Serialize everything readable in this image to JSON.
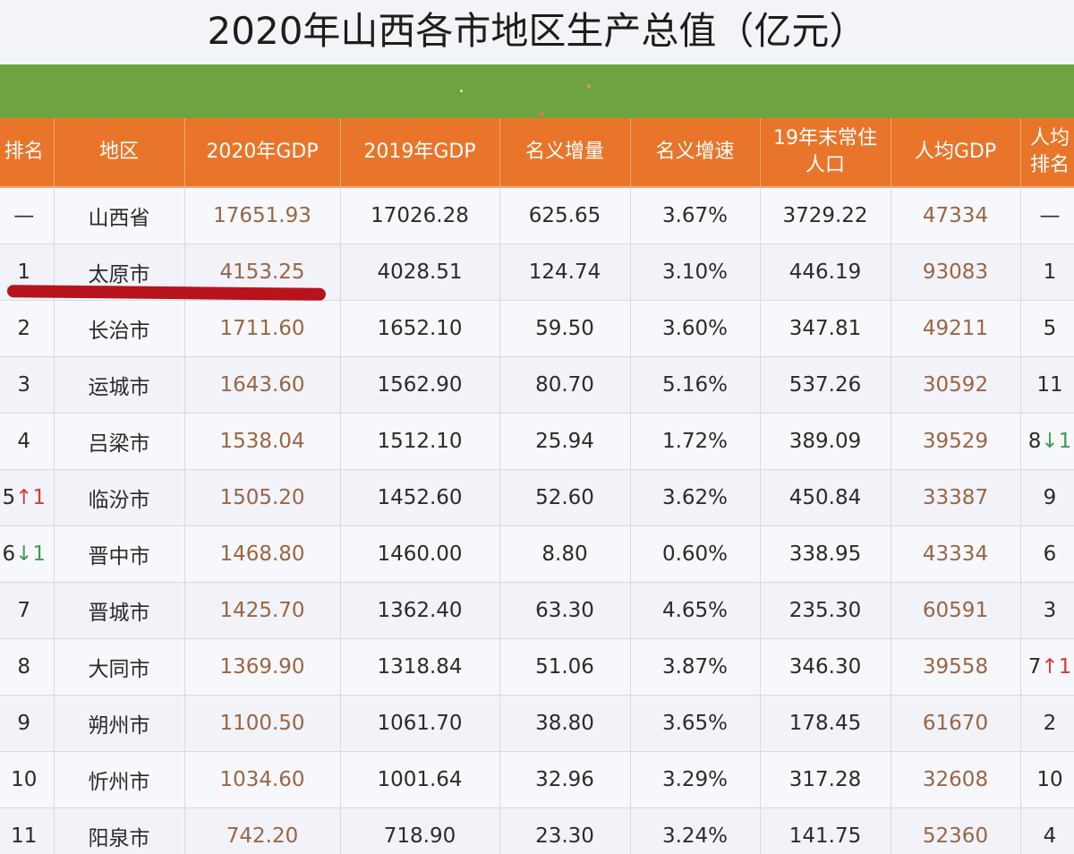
{
  "title": "2020年山西各市地区生产总值（亿元）",
  "headers": {
    "rank": "排名",
    "region": "地区",
    "gdp2020": "2020年GDP",
    "gdp2019": "2019年GDP",
    "increment": "名义增量",
    "growth": "名义增速",
    "population_line1": "19年末常住",
    "population_line2": "人口",
    "per_capita": "人均GDP",
    "pc_rank_line1": "人均",
    "pc_rank_line2": "排名"
  },
  "rows": [
    {
      "rank": "—",
      "rank_arrow": "",
      "region": "山西省",
      "gdp2020": "17651.93",
      "gdp2019": "17026.28",
      "increment": "625.65",
      "growth": "3.67%",
      "population": "3729.22",
      "per_capita": "47334",
      "pc_rank": "—",
      "pc_rank_arrow": ""
    },
    {
      "rank": "1",
      "rank_arrow": "",
      "region": "太原市",
      "gdp2020": "4153.25",
      "gdp2019": "4028.51",
      "increment": "124.74",
      "growth": "3.10%",
      "population": "446.19",
      "per_capita": "93083",
      "pc_rank": "1",
      "pc_rank_arrow": ""
    },
    {
      "rank": "2",
      "rank_arrow": "",
      "region": "长治市",
      "gdp2020": "1711.60",
      "gdp2019": "1652.10",
      "increment": "59.50",
      "growth": "3.60%",
      "population": "347.81",
      "per_capita": "49211",
      "pc_rank": "5",
      "pc_rank_arrow": ""
    },
    {
      "rank": "3",
      "rank_arrow": "",
      "region": "运城市",
      "gdp2020": "1643.60",
      "gdp2019": "1562.90",
      "increment": "80.70",
      "growth": "5.16%",
      "population": "537.26",
      "per_capita": "30592",
      "pc_rank": "11",
      "pc_rank_arrow": ""
    },
    {
      "rank": "4",
      "rank_arrow": "",
      "region": "吕梁市",
      "gdp2020": "1538.04",
      "gdp2019": "1512.10",
      "increment": "25.94",
      "growth": "1.72%",
      "population": "389.09",
      "per_capita": "39529",
      "pc_rank": "8",
      "pc_rank_arrow": "↓1"
    },
    {
      "rank": "5",
      "rank_arrow": "↑1",
      "region": "临汾市",
      "gdp2020": "1505.20",
      "gdp2019": "1452.60",
      "increment": "52.60",
      "growth": "3.62%",
      "population": "450.84",
      "per_capita": "33387",
      "pc_rank": "9",
      "pc_rank_arrow": ""
    },
    {
      "rank": "6",
      "rank_arrow": "↓1",
      "region": "晋中市",
      "gdp2020": "1468.80",
      "gdp2019": "1460.00",
      "increment": "8.80",
      "growth": "0.60%",
      "population": "338.95",
      "per_capita": "43334",
      "pc_rank": "6",
      "pc_rank_arrow": ""
    },
    {
      "rank": "7",
      "rank_arrow": "",
      "region": "晋城市",
      "gdp2020": "1425.70",
      "gdp2019": "1362.40",
      "increment": "63.30",
      "growth": "4.65%",
      "population": "235.30",
      "per_capita": "60591",
      "pc_rank": "3",
      "pc_rank_arrow": ""
    },
    {
      "rank": "8",
      "rank_arrow": "",
      "region": "大同市",
      "gdp2020": "1369.90",
      "gdp2019": "1318.84",
      "increment": "51.06",
      "growth": "3.87%",
      "population": "346.30",
      "per_capita": "39558",
      "pc_rank": "7",
      "pc_rank_arrow": "↑1"
    },
    {
      "rank": "9",
      "rank_arrow": "",
      "region": "朔州市",
      "gdp2020": "1100.50",
      "gdp2019": "1061.70",
      "increment": "38.80",
      "growth": "3.65%",
      "population": "178.45",
      "per_capita": "61670",
      "pc_rank": "2",
      "pc_rank_arrow": ""
    },
    {
      "rank": "10",
      "rank_arrow": "",
      "region": "忻州市",
      "gdp2020": "1034.60",
      "gdp2019": "1001.64",
      "increment": "32.96",
      "growth": "3.29%",
      "population": "317.28",
      "per_capita": "32608",
      "pc_rank": "10",
      "pc_rank_arrow": ""
    },
    {
      "rank": "11",
      "rank_arrow": "",
      "region": "阳泉市",
      "gdp2020": "742.20",
      "gdp2019": "718.90",
      "increment": "23.30",
      "growth": "3.24%",
      "population": "141.75",
      "per_capita": "52360",
      "pc_rank": "4",
      "pc_rank_arrow": ""
    }
  ],
  "colors": {
    "header_bg": "#e8752a",
    "band_green": "#6ea43f",
    "value_brown": "#9a6544",
    "arrow_up": "#d9393b",
    "arrow_down": "#3b9d55",
    "marker_red": "#b7131d"
  }
}
